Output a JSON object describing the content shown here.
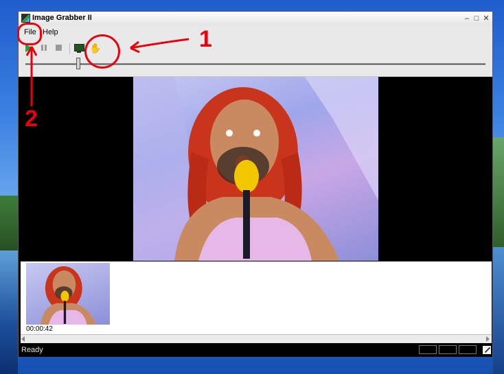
{
  "window": {
    "title": "Image Grabber II",
    "minimize_icon": "minimize-icon",
    "maximize_icon": "maximize-icon",
    "close_icon": "close-icon"
  },
  "menu": {
    "items": [
      {
        "label": "File"
      },
      {
        "label": "Help"
      }
    ]
  },
  "toolbar": {
    "buttons": [
      {
        "icon": "play-icon",
        "state": "active"
      },
      {
        "icon": "pause-icon",
        "state": "disabled"
      },
      {
        "icon": "stop-icon",
        "state": "disabled"
      },
      {
        "icon": "monitor-icon"
      },
      {
        "icon": "grab-frame-icon"
      }
    ]
  },
  "seekbar": {
    "position_fraction": 0.11
  },
  "thumbnails": [
    {
      "time": "00:00:42"
    }
  ],
  "status": {
    "text": "Ready"
  },
  "annotations": {
    "label_1": "1",
    "label_2": "2",
    "color": "#e8000c"
  }
}
